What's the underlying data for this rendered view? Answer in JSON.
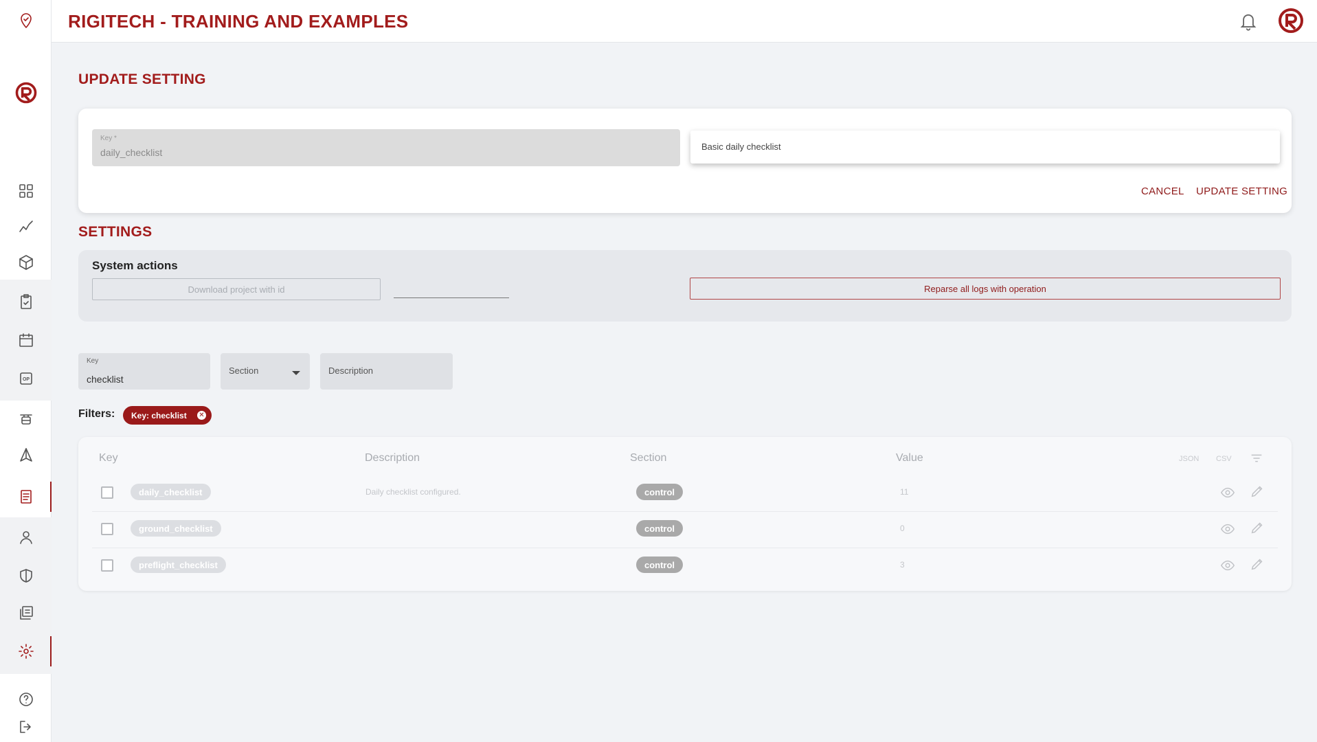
{
  "header": {
    "title": "RIGITECH - TRAINING AND EXAMPLES"
  },
  "sidebar": {
    "items": [
      {
        "icon": "location-pin-icon"
      },
      {
        "icon": "dashboard-grid-icon"
      },
      {
        "icon": "analytics-icon"
      },
      {
        "icon": "cube-icon"
      },
      {
        "icon": "clipboard-check-icon"
      },
      {
        "icon": "calendar-icon"
      },
      {
        "icon": "op-icon"
      },
      {
        "icon": "drone-icon"
      },
      {
        "icon": "aircraft-icon"
      },
      {
        "icon": "document-icon"
      },
      {
        "icon": "user-icon"
      },
      {
        "icon": "shield-icon"
      },
      {
        "icon": "library-icon"
      },
      {
        "icon": "gear-icon"
      },
      {
        "icon": "help-icon"
      },
      {
        "icon": "logout-icon"
      }
    ]
  },
  "update_setting": {
    "title": "UPDATE SETTING",
    "key_label": "Key *",
    "key_value": "daily_checklist",
    "dropdown_option": "Basic daily checklist",
    "cancel_label": "CANCEL",
    "submit_label": "UPDATE SETTING"
  },
  "settings": {
    "title": "SETTINGS",
    "system_actions_title": "System actions",
    "download_button": "Download project with id",
    "reparse_button": "Reparse all logs with operation"
  },
  "filters": {
    "key_label": "Key",
    "key_value": "checklist",
    "section_placeholder": "Section",
    "description_placeholder": "Description",
    "filters_label": "Filters:",
    "active_chip": "Key: checklist"
  },
  "table": {
    "columns": [
      "Key",
      "Description",
      "Section",
      "Value"
    ],
    "export_json": "JSON",
    "export_csv": "CSV",
    "rows": [
      {
        "key": "daily_checklist",
        "description": "Daily checklist configured.",
        "section": "control",
        "value": "11"
      },
      {
        "key": "ground_checklist",
        "description": "",
        "section": "control",
        "value": "0"
      },
      {
        "key": "preflight_checklist",
        "description": "",
        "section": "control",
        "value": "3"
      }
    ]
  },
  "colors": {
    "brand": "#a21c1c",
    "chip": "#9a1a1a",
    "section_pill": "#a9a9a9"
  }
}
